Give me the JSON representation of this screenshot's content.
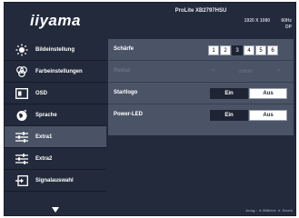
{
  "brand": "iiyama",
  "header": {
    "model": "ProLite XB2797HSU",
    "resolution": "1920 X 1080",
    "frequency_line1": "60Hz",
    "frequency_line2": "DP"
  },
  "sidebar": {
    "items": [
      {
        "label": "Bildeinstellung",
        "icon": "brightness-icon"
      },
      {
        "label": "Farbeinstellungen",
        "icon": "color-palette-icon"
      },
      {
        "label": "OSD",
        "icon": "osd-icon"
      },
      {
        "label": "Sprache",
        "icon": "globe-icon"
      },
      {
        "label": "Extra1",
        "icon": "sliders-icon"
      },
      {
        "label": "Extra2",
        "icon": "sliders-icon"
      },
      {
        "label": "Signalauswahl",
        "icon": "input-icon"
      }
    ],
    "active_index": 4,
    "scroll_icon": "triangle-down-icon"
  },
  "settings": {
    "schaerfe": {
      "label": "Schärfe",
      "options": [
        "1",
        "2",
        "3",
        "4",
        "5",
        "6"
      ],
      "selected": "3"
    },
    "reduz": {
      "label": "Reduz",
      "value": "Vollbild",
      "prev": "<",
      "next": ">"
    },
    "startlogo": {
      "label": "Startlogo",
      "on_label": "Ein",
      "off_label": "Aus",
      "state": "Ein"
    },
    "powerled": {
      "label": "Power-LED",
      "on_label": "Ein",
      "off_label": "Aus",
      "state": "Ein"
    }
  },
  "footer": {
    "hint": "Ausg.: ◄   Wählen: ► Druck"
  },
  "colors": {
    "background": "#232a3c",
    "panel": "#4b5467",
    "active": "#4a5266",
    "selected": "#1e2433"
  }
}
